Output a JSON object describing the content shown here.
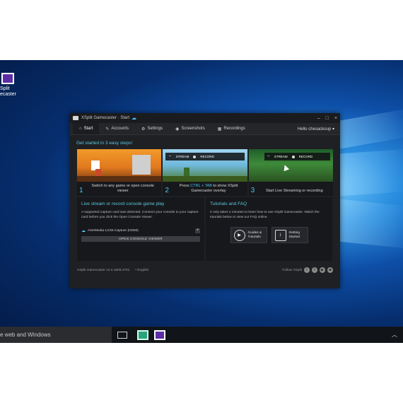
{
  "desktop": {
    "icon_label_line1": "Split",
    "icon_label_line2": "ecaster"
  },
  "window": {
    "title": "XSplit Gamecaster · Start",
    "min_label": "–",
    "max_label": "□",
    "close_label": "×",
    "tabs": [
      {
        "icon": "⌂",
        "label": "Start"
      },
      {
        "icon": "✎",
        "label": "Accounts"
      },
      {
        "icon": "⚙",
        "label": "Settings"
      },
      {
        "icon": "◉",
        "label": "Screenshots"
      },
      {
        "icon": "▦",
        "label": "Recordings"
      }
    ],
    "hello": "Hello chesackoup ▾",
    "get_started": "Get started in 3 easy steps!",
    "steps": [
      {
        "num": "1",
        "caption": "Switch to any game or open console viewer"
      },
      {
        "num": "2",
        "caption_pre": "Press ",
        "caption_hl": "CTRL + TAB",
        "caption_post": " to show XSplit Gamecaster overlay"
      },
      {
        "num": "3",
        "caption": "Start Live Streaming or recording"
      }
    ],
    "overlay": {
      "stream": "STREAM",
      "record": "RECORD"
    },
    "live_panel": {
      "title": "Live stream or record console game play",
      "text": "A supported capture card was detected. Connect your console to your capture card before you click the Open Console Viewer.",
      "device": "AVerMedia LGX5 Capture (HDMI)",
      "plus": "+",
      "open_button": "OPEN CONSOLE VIEWER"
    },
    "tutorials_panel": {
      "title": "Tutorials and FAQ",
      "text": "It only takes 2 minutes to learn how to use XSplit Gamecaster. Watch the tutorials below or view our FAQ online.",
      "guides_label_1": "Guides &",
      "guides_label_2": "Tutorials",
      "getting_label_1": "Getting",
      "getting_label_2": "Started"
    },
    "footer": {
      "version": "XSplit Gamecaster v2.0.1608.2701",
      "language": "• English",
      "follow": "Follow XSplit"
    }
  },
  "taskbar": {
    "search_text": "e web and Windows",
    "tray": "︿"
  }
}
